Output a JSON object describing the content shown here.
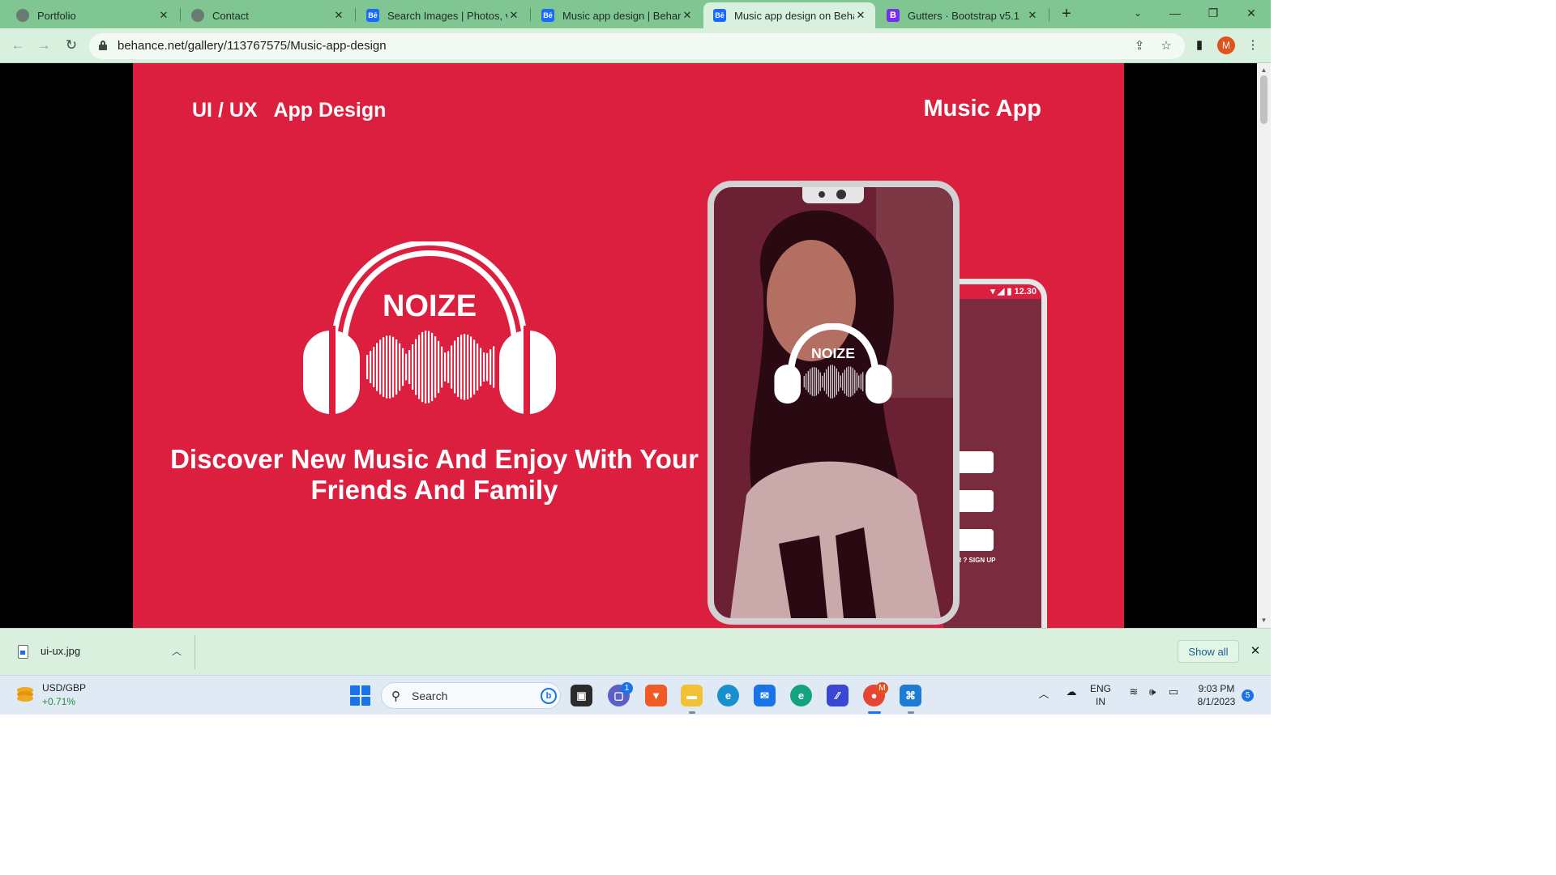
{
  "browser": {
    "tabs": [
      {
        "title": "Portfolio",
        "icon": "globe-icon",
        "active": false
      },
      {
        "title": "Contact",
        "icon": "globe-icon",
        "active": false
      },
      {
        "title": "Search Images | Photos, vid",
        "icon": "behance-icon",
        "active": false
      },
      {
        "title": "Music app design | Behance",
        "icon": "behance-icon",
        "active": false
      },
      {
        "title": "Music app design on Behan",
        "icon": "behance-icon",
        "active": true
      },
      {
        "title": "Gutters · Bootstrap v5.1",
        "icon": "bootstrap-icon",
        "active": false
      }
    ],
    "url": "behance.net/gallery/113767575/Music-app-design",
    "profile_initial": "M",
    "accent_color": "#7fc693"
  },
  "page": {
    "title_left": "UI / UX   App Design",
    "title_right": "Music App",
    "logo_text": "NOIZE",
    "tagline_line1": "Discover New Music And Enjoy With Your",
    "tagline_line2": "Friends And Family",
    "brand_color": "#dc1f3f",
    "phone_back_time": "12.30",
    "phone_back_signup": "USER ? SIGN UP"
  },
  "downloads": {
    "file_name": "ui-ux.jpg",
    "show_all": "Show all"
  },
  "taskbar": {
    "widget_name": "USD/GBP",
    "widget_change": "+0.71%",
    "search_placeholder": "Search",
    "teams_badge": "1",
    "chrome_badge": "M",
    "language_line1": "ENG",
    "language_line2": "IN",
    "time": "9:03 PM",
    "date": "8/1/2023",
    "notification_count": "5"
  }
}
